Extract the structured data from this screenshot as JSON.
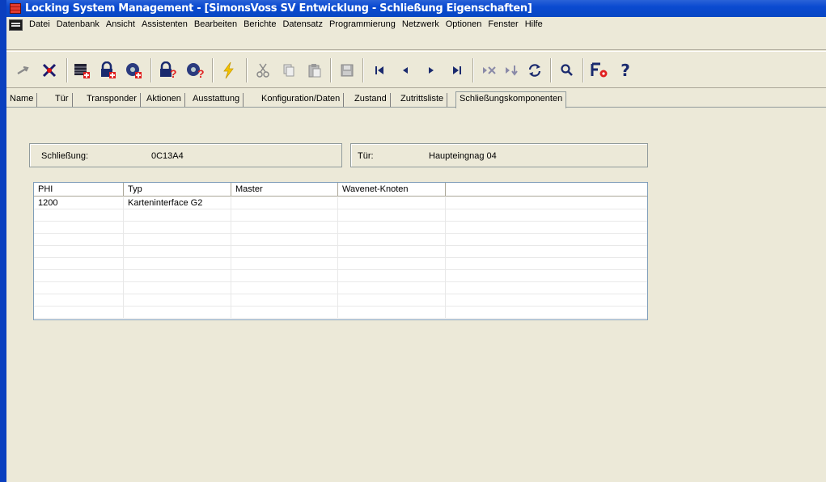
{
  "window": {
    "title": "Locking System Management - [SimonsVoss SV Entwicklung - Schließung Eigenschaften]"
  },
  "menu": {
    "items": [
      "Datei",
      "Datenbank",
      "Ansicht",
      "Assistenten",
      "Bearbeiten",
      "Berichte",
      "Datensatz",
      "Programmierung",
      "Netzwerk",
      "Optionen",
      "Fenster",
      "Hilfe"
    ]
  },
  "toolbar": {
    "icons": [
      "swap-icon",
      "delete-x-icon",
      "new-grid-icon",
      "new-lock-icon",
      "new-transponder-icon",
      "lock-query-icon",
      "transponder-query-icon",
      "program-lightning-icon",
      "cut-icon",
      "copy-icon",
      "paste-icon",
      "save-icon",
      "first-record-icon",
      "prev-record-icon",
      "next-record-icon",
      "last-record-icon",
      "delete-record-icon",
      "import-record-icon",
      "refresh-icon",
      "search-icon",
      "filter-settings-icon",
      "help-icon"
    ]
  },
  "tabs": {
    "items": [
      "Name",
      "Tür",
      "Transponder",
      "Aktionen",
      "Ausstattung",
      "Konfiguration/Daten",
      "Zustand",
      "Zutrittsliste",
      "Schließungskomponenten"
    ],
    "active": "Schließungskomponenten"
  },
  "info": {
    "lock_label": "Schließung:",
    "lock_value": "0C13A4",
    "door_label": "Tür:",
    "door_value": "Haupteingnag 04"
  },
  "grid": {
    "columns": [
      "PHI",
      "Typ",
      "Master",
      "Wavenet-Knoten",
      ""
    ],
    "rows": [
      [
        "1200",
        "Karteninterface G2",
        "",
        "",
        ""
      ]
    ]
  },
  "colors": {
    "titlebar": "#0a4ad0",
    "window_bg": "#ece9d8"
  }
}
